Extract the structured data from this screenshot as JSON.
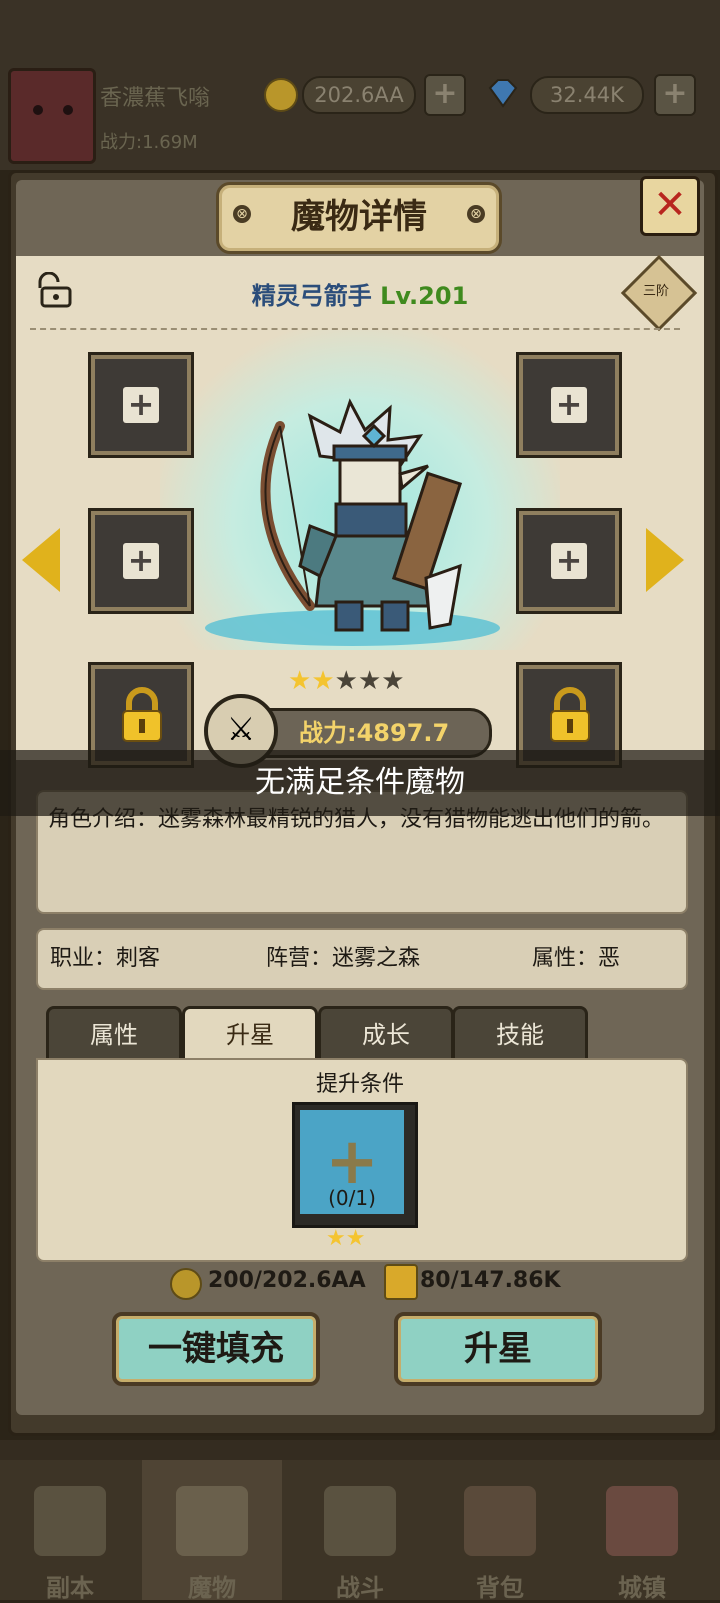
{
  "top": {
    "player_name": "香濃蕉飞嗡",
    "power_label": "战力:1.69M",
    "gold": "202.6AA",
    "gems": "32.44K"
  },
  "panel": {
    "title": "魔物详情",
    "hero_name": "精灵弓箭手",
    "hero_level": "Lv.201",
    "rank": "三阶",
    "stars_filled": 2,
    "stars_total": 5,
    "power": "战力:4897.7",
    "toast": "无满足条件魔物",
    "description": "角色介绍：迷雾森林最精锐的猎人，没有猎物能逃出他们的箭。",
    "class": "职业：刺客",
    "faction": "阵营：迷雾之森",
    "attribute": "属性：恶",
    "tabs": [
      {
        "label": "属性"
      },
      {
        "label": "升星"
      },
      {
        "label": "成长"
      },
      {
        "label": "技能"
      }
    ],
    "requirement_title": "提升条件",
    "requirement_count": "(0/1)",
    "requirement_stars": 2,
    "cost_gold": "200/202.6AA",
    "cost_scroll": "80/147.86K",
    "btn_autofill": "一键填充",
    "btn_upgrade": "升星"
  },
  "nav": [
    {
      "label": "副本"
    },
    {
      "label": "魔物"
    },
    {
      "label": "战斗"
    },
    {
      "label": "背包"
    },
    {
      "label": "城镇"
    }
  ],
  "colors": {
    "accent_gold": "#e0b21c",
    "level_green": "#3f8a1e",
    "name_blue": "#2b4d7a",
    "button_teal": "#8fd1c3",
    "close_red": "#b8261e"
  }
}
